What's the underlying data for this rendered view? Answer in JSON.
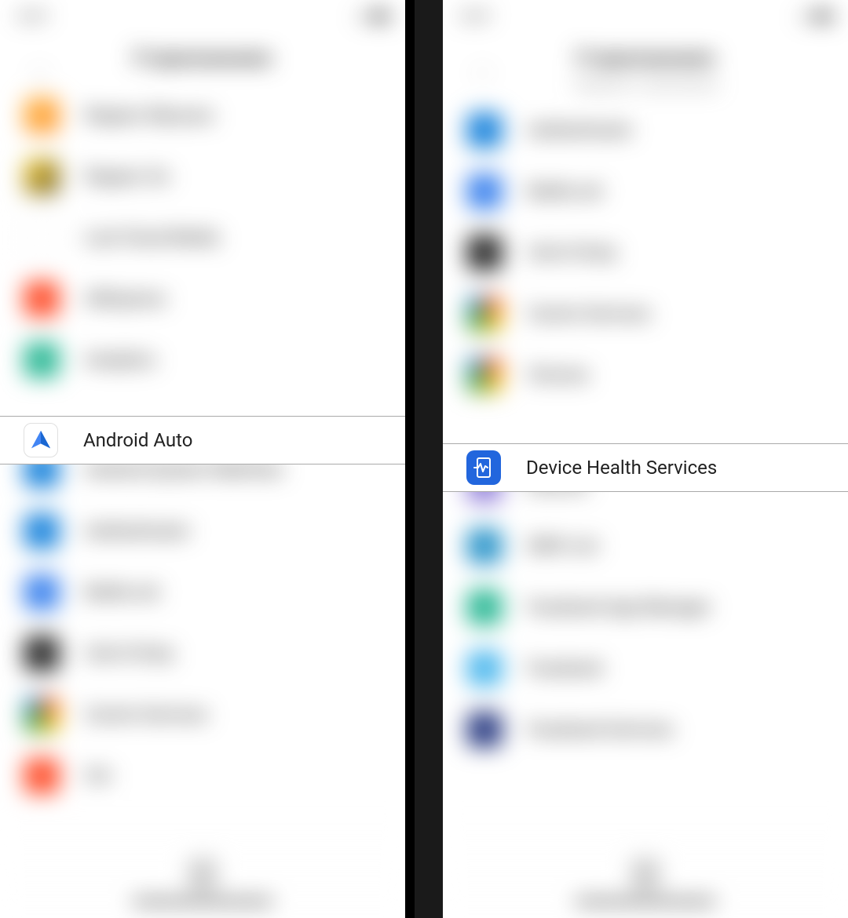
{
  "left_screen": {
    "page_title": "П приложениях",
    "status_time": "10:47",
    "sharp_app": "Android Auto",
    "sharp_app_icon": "android-auto-icon",
    "blurred_apps_before": [
      {
        "name": "Яндекс Музыка",
        "icon_class": "ic-orange"
      },
      {
        "name": "Яндекс Go",
        "icon_class": "ic-yellow"
      },
      {
        "name": "Last Cloud Media",
        "icon_class": "ic-white"
      },
      {
        "name": "AliExpress",
        "icon_class": "ic-red"
      },
      {
        "name": "Analytics",
        "icon_class": "ic-teal"
      }
    ],
    "blurred_apps_after": [
      {
        "name": "Android System WebView",
        "icon_class": "ic-blue"
      },
      {
        "name": "Authenticator",
        "icon_class": "ic-blue"
      },
      {
        "name": "Battle.net",
        "icon_class": "ic-blue2"
      },
      {
        "name": "Call of Duty",
        "icon_class": "ic-dark"
      },
      {
        "name": "Carrier Services",
        "icon_class": "ic-multi"
      },
      {
        "name": "Chr",
        "icon_class": "ic-red"
      }
    ]
  },
  "right_screen": {
    "page_title": "П приложениях",
    "status_time": "10:47",
    "page_subtitle": "Сведения о приложении",
    "sharp_app": "Device Health Services",
    "sharp_app_icon": "device-health-icon",
    "blurred_apps_before": [
      {
        "name": "Authenticator",
        "icon_class": "ic-blue"
      },
      {
        "name": "Battle.net",
        "icon_class": "ic-blue2"
      },
      {
        "name": "Call of Duty",
        "icon_class": "ic-dark"
      },
      {
        "name": "Carrier Services",
        "icon_class": "ic-multi"
      },
      {
        "name": "Chrome",
        "icon_class": "ic-multi"
      }
    ],
    "blurred_apps_after": [
      {
        "name": "Discord",
        "icon_class": "ic-purple"
      },
      {
        "name": "DMV List",
        "icon_class": "ic-blue3"
      },
      {
        "name": "Facebook App Manager",
        "icon_class": "ic-teal"
      },
      {
        "name": "Facebook",
        "icon_class": "ic-lightblue"
      },
      {
        "name": "Facebook Services",
        "icon_class": "ic-darkblue"
      }
    ]
  }
}
